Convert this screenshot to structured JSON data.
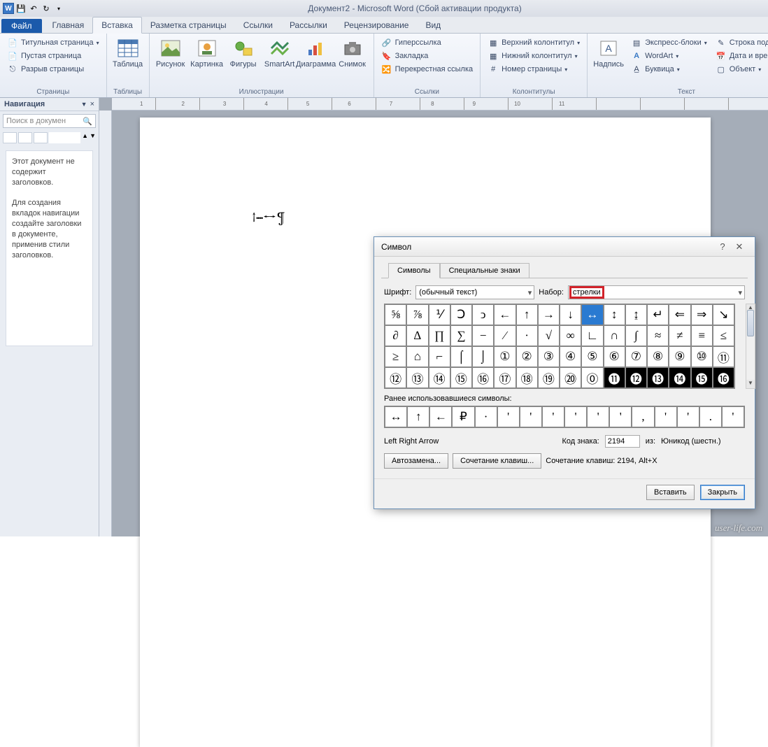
{
  "titlebar": {
    "title": "Документ2 - Microsoft Word (Сбой активации продукта)"
  },
  "tabs": {
    "file": "Файл",
    "home": "Главная",
    "insert": "Вставка",
    "layout": "Разметка страницы",
    "refs": "Ссылки",
    "mail": "Рассылки",
    "review": "Рецензирование",
    "view": "Вид"
  },
  "ribbon": {
    "pages": {
      "cover": "Титульная страница",
      "blank": "Пустая страница",
      "break": "Разрыв страницы",
      "label": "Страницы"
    },
    "tables": {
      "btn": "Таблица",
      "label": "Таблицы"
    },
    "illus": {
      "pic": "Рисунок",
      "clip": "Картинка",
      "shapes": "Фигуры",
      "smart": "SmartArt",
      "chart": "Диаграмма",
      "shot": "Снимок",
      "label": "Иллюстрации"
    },
    "links": {
      "hyper": "Гиперссылка",
      "book": "Закладка",
      "cross": "Перекрестная ссылка",
      "label": "Ссылки"
    },
    "hf": {
      "header": "Верхний колонтитул",
      "footer": "Нижний колонтитул",
      "num": "Номер страницы",
      "label": "Колонтитулы"
    },
    "text": {
      "box": "Надпись",
      "quick": "Экспресс-блоки",
      "wordart": "WordArt",
      "drop": "Буквица",
      "sig": "Строка подпи",
      "date": "Дата и время",
      "obj": "Объект",
      "label": "Текст"
    }
  },
  "nav": {
    "title": "Навигация",
    "search_ph": "Поиск в докумен",
    "msg1": "Этот документ не содержит заголовков.",
    "msg2": "Для создания вкладок навигации создайте заголовки в документе, применив стили заголовков."
  },
  "doc": {
    "content": "↑····↔¶"
  },
  "ruler": [
    "1",
    "2",
    "3",
    "4",
    "5",
    "6",
    "7",
    "8",
    "9",
    "10",
    "11"
  ],
  "dialog": {
    "title": "Символ",
    "tab1": "Символы",
    "tab2": "Специальные знаки",
    "font_lbl": "Шрифт:",
    "font_val": "(обычный текст)",
    "set_lbl": "Набор:",
    "set_val": "стрелки",
    "grid": [
      "⅝",
      "⅞",
      "⅟",
      "Ↄ",
      "ↄ",
      "←",
      "↑",
      "→",
      "↓",
      "↔",
      "↕",
      "↨",
      "↵",
      "⇐",
      "⇒",
      "↘",
      "∂",
      "∆",
      "∏",
      "∑",
      "−",
      "∕",
      "∙",
      "√",
      "∞",
      "∟",
      "∩",
      "∫",
      "≈",
      "≠",
      "≡",
      "≤",
      "≥",
      "⌂",
      "⌐",
      "⌠",
      "⌡",
      "①",
      "②",
      "③",
      "④",
      "⑤",
      "⑥",
      "⑦",
      "⑧",
      "⑨",
      "⑩",
      "⑪",
      "⑫",
      "⑬",
      "⑭",
      "⑮",
      "⑯",
      "⑰",
      "⑱",
      "⑲",
      "⑳",
      "⓪",
      "⓫",
      "⓬",
      "⓭",
      "⓮",
      "⓯",
      "⓰"
    ],
    "selected_idx": 9,
    "black_start": 58,
    "recent_lbl": "Ранее использовавшиеся символы:",
    "recent": [
      "↔",
      "↑",
      "←",
      "₽",
      "·",
      "'",
      "'",
      "'",
      "'",
      "'",
      "'",
      ",",
      "'",
      "'",
      ".",
      "'"
    ],
    "char_name": "Left Right Arrow",
    "code_lbl": "Код знака:",
    "code_val": "2194",
    "from_lbl": "из:",
    "from_val": "Юникод (шестн.)",
    "auto": "Автозамена...",
    "shortcut": "Сочетание клавиш...",
    "sh_lbl": "Сочетание клавиш: 2194, Alt+X",
    "insert": "Вставить",
    "close": "Закрыть"
  },
  "watermark": "user-life.com"
}
